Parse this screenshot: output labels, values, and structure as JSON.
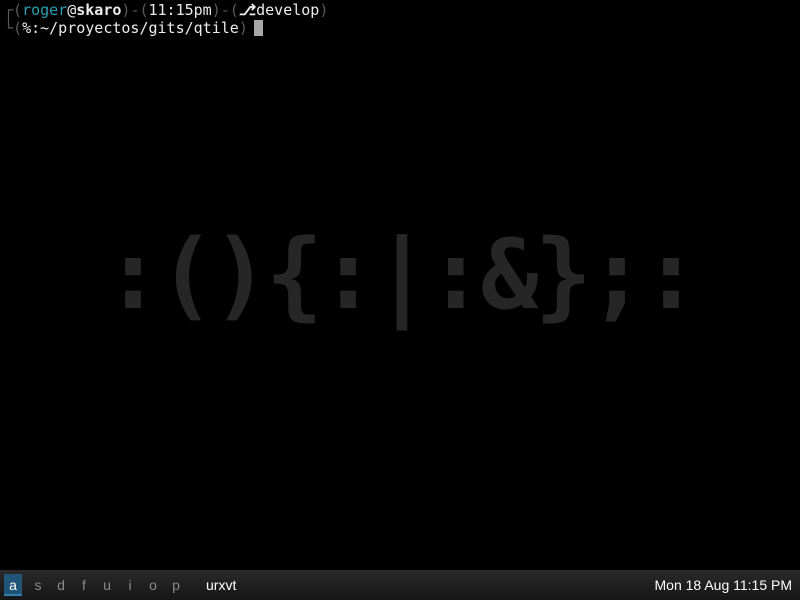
{
  "terminal": {
    "line1": {
      "corner": "┌",
      "open1": "(",
      "user": "roger",
      "at": "@",
      "host": "skaro",
      "close1": ")",
      "sep1": "-",
      "open2": "(",
      "time": "11:15pm",
      "close2": ")",
      "sep2": "-",
      "open3": "(",
      "git_icon": "⎇",
      "branch": "develop",
      "close3": ")"
    },
    "line2": {
      "corner": "└",
      "open1": "(",
      "prompt_symbol": "%",
      "path": ":~/proyectos/gits/qtile",
      "close1": ")"
    }
  },
  "wallpaper": {
    "text": ":(){:|:&};:"
  },
  "bar": {
    "groups": [
      "a",
      "s",
      "d",
      "f",
      "u",
      "i",
      "o",
      "p"
    ],
    "active_group": "a",
    "window_name": "urxvt",
    "clock": "Mon 18 Aug 11:15 PM"
  },
  "colors": {
    "background": "#000000",
    "prompt_cyan": "#2aa1b3",
    "bracket_gray": "#5a5a5a",
    "wallpaper_text": "#262626",
    "active_group_bg": "#215578"
  }
}
